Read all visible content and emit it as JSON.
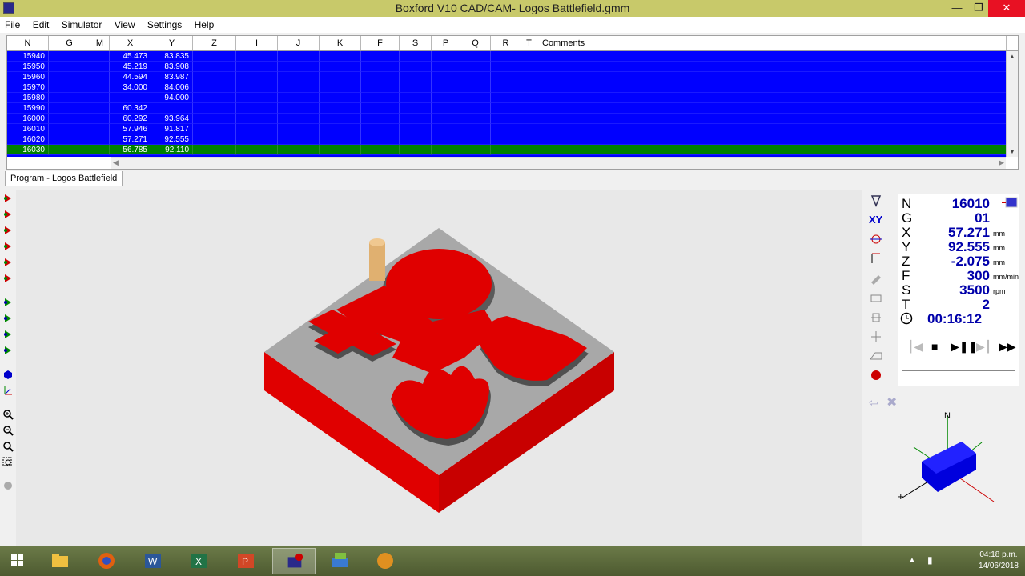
{
  "window": {
    "title": "Boxford V10 CAD/CAM- Logos Battlefield.gmm"
  },
  "menu": [
    "File",
    "Edit",
    "Simulator",
    "View",
    "Settings",
    "Help"
  ],
  "grid": {
    "columns": [
      "N",
      "G",
      "M",
      "X",
      "Y",
      "Z",
      "I",
      "J",
      "K",
      "F",
      "S",
      "P",
      "Q",
      "R",
      "T",
      "Comments"
    ],
    "rows": [
      {
        "N": "15940",
        "X": "45.473",
        "Y": "83.835"
      },
      {
        "N": "15950",
        "X": "45.219",
        "Y": "83.908"
      },
      {
        "N": "15960",
        "X": "44.594",
        "Y": "83.987"
      },
      {
        "N": "15970",
        "X": "34.000",
        "Y": "84.006"
      },
      {
        "N": "15980",
        "X": "",
        "Y": "94.000"
      },
      {
        "N": "15990",
        "X": "60.342",
        "Y": ""
      },
      {
        "N": "16000",
        "X": "60.292",
        "Y": "93.964"
      },
      {
        "N": "16010",
        "X": "57.946",
        "Y": "91.817"
      },
      {
        "N": "16020",
        "X": "57.271",
        "Y": "92.555"
      },
      {
        "N": "16030",
        "X": "56.785",
        "Y": "92.110",
        "selected": true
      }
    ]
  },
  "tab": {
    "label": "Program - Logos Battlefield"
  },
  "dro": {
    "N": "16010",
    "G": "01",
    "X": "57.271",
    "Y": "92.555",
    "Z": "-2.075",
    "F": "300",
    "S": "3500",
    "T": "2",
    "time": "00:16:12",
    "units": {
      "X": "mm",
      "Y": "mm",
      "Z": "mm",
      "F": "mm/min",
      "S": "rpm"
    },
    "xy_label": "XY"
  },
  "taskbar": {
    "time": "04:18 p.m.",
    "date": "14/06/2018"
  },
  "colors": {
    "grid_bg": "#0000ff",
    "grid_selected": "#008000",
    "part_red": "#e00000",
    "dro_value": "#0000aa",
    "title_bar": "#c8c96a"
  },
  "icons": [
    "windows-start-icon",
    "file-explorer-icon",
    "firefox-icon",
    "word-icon",
    "excel-icon",
    "powerpoint-icon",
    "boxford-v10-icon",
    "boxford-3d-icon",
    "hand-icon"
  ]
}
